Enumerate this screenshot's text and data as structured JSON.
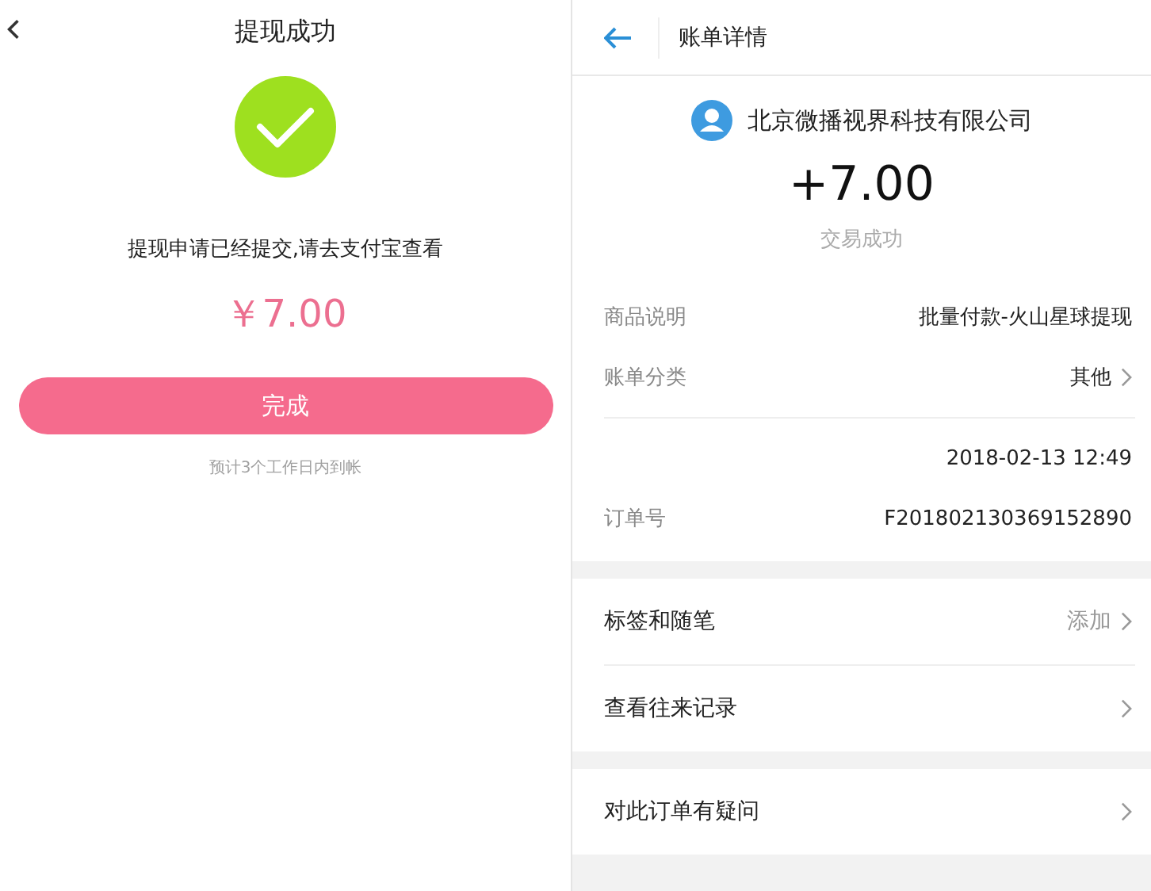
{
  "withdraw_screen": {
    "title": "提现成功",
    "message": "提现申请已经提交,请去支付宝查看",
    "amount": "￥7.00",
    "button": "完成",
    "note": "预计3个工作日内到帐"
  },
  "bill_screen": {
    "title": "账单详情",
    "payee": "北京微播视界科技有限公司",
    "amount": "+7.00",
    "status": "交易成功",
    "groups": [
      {
        "sections": [
          {
            "rows": [
              {
                "kind": "info",
                "label": "商品说明",
                "value": "批量付款-火山星球提现"
              },
              {
                "kind": "link",
                "label": "账单分类",
                "value": "其他",
                "value_muted": false
              }
            ]
          },
          {
            "rows": [
              {
                "kind": "info",
                "value": "2018-02-13 12:49"
              },
              {
                "kind": "info",
                "label": "订单号",
                "value": "F201802130369152890"
              }
            ]
          }
        ]
      },
      {
        "sections": [
          {
            "rows": [
              {
                "kind": "link",
                "label": "标签和随笔",
                "value": "添加",
                "value_muted": true
              }
            ]
          },
          {
            "rows": [
              {
                "kind": "link",
                "label": "查看往来记录"
              }
            ]
          }
        ]
      },
      {
        "sections": [
          {
            "rows": [
              {
                "kind": "link",
                "label": "对此订单有疑问"
              }
            ]
          }
        ]
      }
    ]
  }
}
